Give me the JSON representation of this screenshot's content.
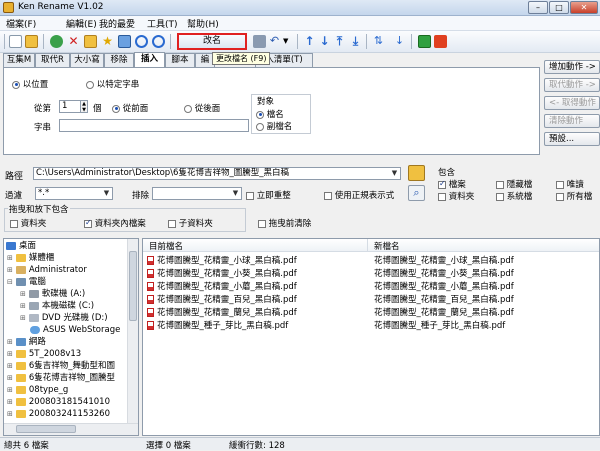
{
  "app": {
    "title": "Ken Rename V1.02"
  },
  "menu": [
    "檔案(F)",
    "編輯(E)",
    "我的最愛",
    "工具(T)",
    "幫助(H)"
  ],
  "toolbar": {
    "rename_label": "改名",
    "tooltip": "更改檔名 (F9)"
  },
  "tabs": [
    "互集M",
    "取代R",
    "大小寫",
    "移除",
    "插入",
    "腳本",
    "編",
    "入清單(T)"
  ],
  "active_tab": "插入",
  "insert": {
    "by_position": "以位置",
    "by_string": "以特定字串",
    "from_label": "從第",
    "from_value": "1",
    "count_unit": "個",
    "from_front": "從前面",
    "from_back": "從後面",
    "string_label": "字串",
    "string_value": "",
    "target_label": "對象",
    "target_filename": "檔名",
    "target_ext": "副檔名"
  },
  "side_buttons": [
    {
      "label": "增加動作 ->",
      "enabled": true
    },
    {
      "label": "取代動作 ->",
      "enabled": false
    },
    {
      "label": "<- 取得動作",
      "enabled": false
    },
    {
      "label": "清除動作",
      "enabled": false
    },
    {
      "label": "預設...",
      "enabled": true
    }
  ],
  "path": {
    "label": "路徑",
    "value": "C:\\Users\\Administrator\\Desktop\\6隻花博吉祥物_圖騰型_黑白稿"
  },
  "filter": {
    "label": "過濾",
    "value": "*.*",
    "exclude_label": "排除",
    "exclude_value": "",
    "instant_recheck": "立即重整",
    "use_regex": "使用正規表示式"
  },
  "include": {
    "label": "包含",
    "files": "檔案",
    "folders": "資料夾",
    "hidden": "隱藏檔",
    "system": "系統檔",
    "readonly": "唯讀",
    "all": "所有檔"
  },
  "dragdrop": {
    "label": "拖曳和放下包含",
    "folder": "資料夾",
    "folder_files": "資料夾內檔案",
    "subfolder": "子資料夾",
    "clear_on_drag": "拖曳前清除"
  },
  "tree": [
    {
      "label": "桌面",
      "level": 0,
      "icon": "desktop-icon",
      "expander": "-"
    },
    {
      "label": "媒體櫃",
      "level": 1,
      "icon": "folder-icon",
      "expander": "+"
    },
    {
      "label": "Administrator",
      "level": 1,
      "icon": "user-icon",
      "expander": "+"
    },
    {
      "label": "電腦",
      "level": 1,
      "icon": "computer-icon",
      "expander": "-"
    },
    {
      "label": "軟碟機 (A:)",
      "level": 2,
      "icon": "floppy-icon",
      "expander": "+"
    },
    {
      "label": "本機磁碟 (C:)",
      "level": 2,
      "icon": "disk-icon",
      "expander": "+"
    },
    {
      "label": "DVD 光碟機 (D:)",
      "level": 2,
      "icon": "dvd-icon",
      "expander": "+"
    },
    {
      "label": "ASUS WebStorage",
      "level": 2,
      "icon": "cloud-icon",
      "expander": ""
    },
    {
      "label": "網路",
      "level": 1,
      "icon": "network-icon",
      "expander": "+"
    },
    {
      "label": "5T_2008v13",
      "level": 1,
      "icon": "folder-icon",
      "expander": "+"
    },
    {
      "label": "6隻吉祥物_舞動型和圖",
      "level": 1,
      "icon": "folder-icon",
      "expander": "+"
    },
    {
      "label": "6隻花博吉祥物_圖騰型",
      "level": 1,
      "icon": "folder-icon",
      "expander": "+"
    },
    {
      "label": "08type_g",
      "level": 1,
      "icon": "folder-icon",
      "expander": "+"
    },
    {
      "label": "200803181541010",
      "level": 1,
      "icon": "folder-icon",
      "expander": "+"
    },
    {
      "label": "200803241153260",
      "level": 1,
      "icon": "folder-icon",
      "expander": "+"
    }
  ],
  "files": {
    "col_old": "目前檔名",
    "col_new": "新檔名",
    "rows": [
      {
        "old": "花博圖騰型_花精靈_小球_黑白稿.pdf",
        "new": "花博圖騰型_花精靈_小球_黑白稿.pdf"
      },
      {
        "old": "花博圖騰型_花精靈_小葵_黑白稿.pdf",
        "new": "花博圖騰型_花精靈_小葵_黑白稿.pdf"
      },
      {
        "old": "花博圖騰型_花精靈_小蘑_黑白稿.pdf",
        "new": "花博圖騰型_花精靈_小蘑_黑白稿.pdf"
      },
      {
        "old": "花博圖騰型_花精靈_百兒_黑白稿.pdf",
        "new": "花博圖騰型_花精靈_百兒_黑白稿.pdf"
      },
      {
        "old": "花博圖騰型_花精靈_蘭兒_黑白稿.pdf",
        "new": "花博圖騰型_花精靈_蘭兒_黑白稿.pdf"
      },
      {
        "old": "花博圖騰型_種子_芽比_黑白稿.pdf",
        "new": "花博圖騰型_種子_芽比_黑白稿.pdf"
      }
    ]
  },
  "status": {
    "total": "總共 6 檔案",
    "selected": "選擇 0 檔案",
    "buffer": "緩衝行數: 128"
  }
}
